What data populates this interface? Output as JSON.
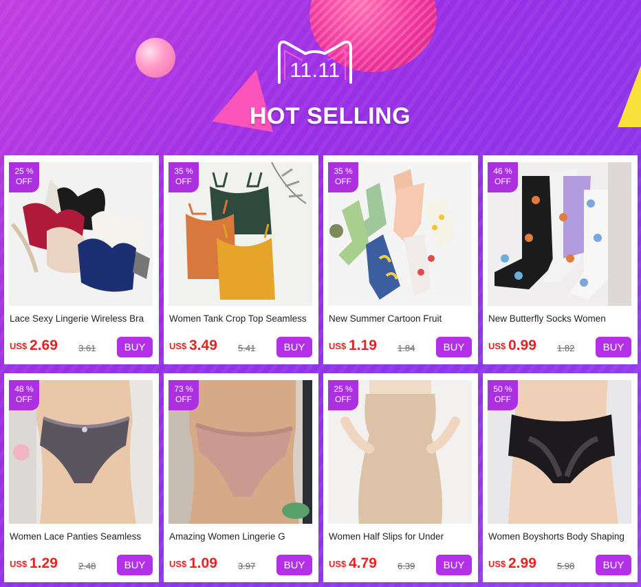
{
  "banner": {
    "badge": "11.11",
    "title": "HOT SELLING"
  },
  "currency": "US$",
  "buy_label": "BUY",
  "products": [
    {
      "discount_pct": "25 %",
      "off": "OFF",
      "name": "Lace Sexy Lingerie Wireless Bra",
      "price": "2.69",
      "old_price": "3.61"
    },
    {
      "discount_pct": "35 %",
      "off": "OFF",
      "name": "Women Tank Crop Top Seamless",
      "price": "3.49",
      "old_price": "5.41"
    },
    {
      "discount_pct": "35 %",
      "off": "OFF",
      "name": "New Summer Cartoon Fruit",
      "price": "1.19",
      "old_price": "1.84"
    },
    {
      "discount_pct": "46 %",
      "off": "OFF",
      "name": "New Butterfly Socks Women",
      "price": "0.99",
      "old_price": "1.82"
    },
    {
      "discount_pct": "48 %",
      "off": "OFF",
      "name": "Women Lace Panties Seamless",
      "price": "1.29",
      "old_price": "2.48"
    },
    {
      "discount_pct": "73 %",
      "off": "OFF",
      "name": "Amazing Women Lingerie G",
      "price": "1.09",
      "old_price": "3.97"
    },
    {
      "discount_pct": "25 %",
      "off": "OFF",
      "name": "Women Half Slips for Under",
      "price": "4.79",
      "old_price": "6.39"
    },
    {
      "discount_pct": "50 %",
      "off": "OFF",
      "name": "Women Boyshorts Body Shaping",
      "price": "2.99",
      "old_price": "5.98"
    }
  ],
  "colors": {
    "accent": "#b32fe8",
    "price": "#e62222",
    "badge": "#ac2fe0"
  }
}
